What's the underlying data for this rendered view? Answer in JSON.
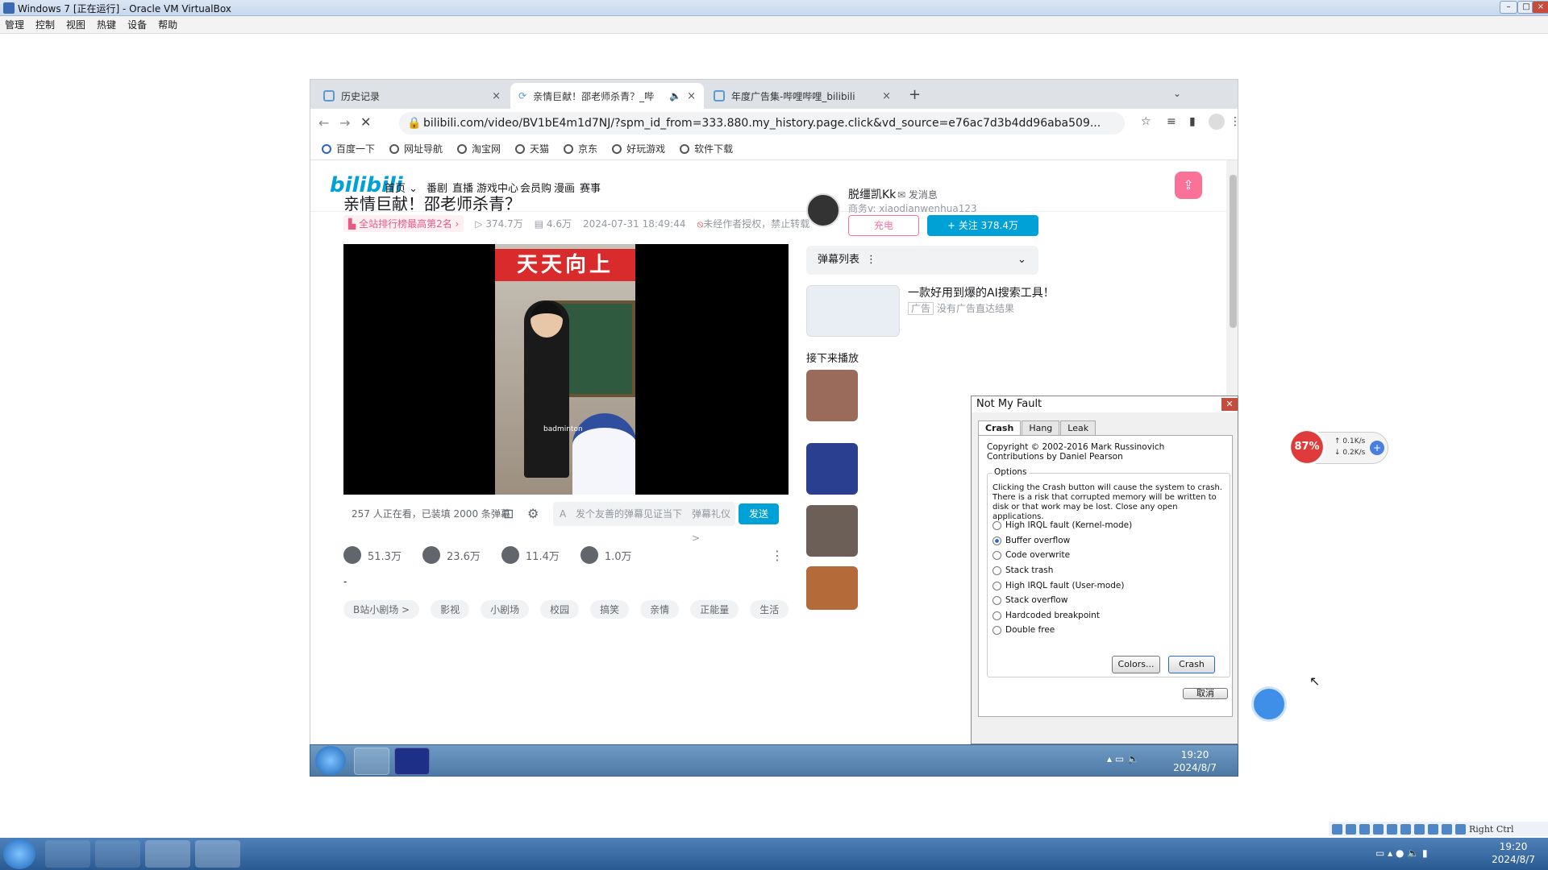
{
  "host": {
    "window_title": "Windows 7 [正在运行] - Oracle VM VirtualBox",
    "menu": [
      "管理",
      "控制",
      "视图",
      "热键",
      "设备",
      "帮助"
    ],
    "clock_time": "19:20",
    "clock_date": "2024/8/7",
    "tray_label": "Right Ctrl"
  },
  "browser": {
    "tabs": [
      {
        "label": "历史记录"
      },
      {
        "label": "亲情巨献！邵老师杀青？_哔"
      },
      {
        "label": "年度广告集-哔哩哔哩_bilibili"
      }
    ],
    "new_tab": "+",
    "url": "bilibili.com/video/BV1bE4m1d7NJ/?spm_id_from=333.880.my_history.page.click&vd_source=e76ac7d3b4dd96aba509...",
    "bookmarks": [
      "百度一下",
      "网址导航",
      "淘宝网",
      "天猫",
      "京东",
      "好玩游戏",
      "软件下载"
    ]
  },
  "bili": {
    "nav": {
      "home": "首页",
      "links": [
        "番剧",
        "直播",
        "游戏中心",
        "会员购",
        "漫画",
        "赛事"
      ]
    },
    "video": {
      "title": "亲情巨献！邵老师杀青？",
      "rank": "全站排行榜最高第2名",
      "views": "374.7万",
      "danmaku": "4.6万",
      "date": "2024-07-31 18:49:44",
      "copyright": "未经作者授权，禁止转载",
      "frame_banner": "天天向上",
      "frame_caption": "badminton"
    },
    "danmu_bar": {
      "viewers": "257 人正在看，已装填 2000 条弹幕",
      "placeholder": "发个友善的弹幕见证当下",
      "etiquette": "弹幕礼仪 >",
      "send": "发送"
    },
    "actions": {
      "like": "51.3万",
      "coin": "23.6万",
      "fav": "11.4万",
      "share": "1.0万"
    },
    "desc": "-",
    "tags": [
      "B站小剧场 >",
      "影视",
      "小剧场",
      "校园",
      "搞笑",
      "亲情",
      "正能量",
      "生活"
    ],
    "up": {
      "name": "脱缰凯Kk",
      "msg": "发消息",
      "desc": "商务v: xiaodianwenhua123",
      "charge": "充电",
      "follow": "+ 关注 378.4万"
    },
    "danmu_list": "弹幕列表",
    "ad": {
      "title": "一款好用到爆的AI搜索工具！",
      "badge": "广告",
      "sub": "没有广告直达结果"
    },
    "next_label": "接下来播放"
  },
  "nmf": {
    "title": "Not My Fault",
    "tabs": [
      "Crash",
      "Hang",
      "Leak"
    ],
    "copyright": "Copyright © 2002-2016 Mark Russinovich",
    "contrib": "Contributions by Daniel Pearson",
    "options_label": "Options",
    "warning": "Clicking the Crash button will cause the system to crash. There is a risk that corrupted memory will be written to disk or that work may be lost. Close any open applications.",
    "options": [
      "High IRQL fault (Kernel-mode)",
      "Buffer overflow",
      "Code overwrite",
      "Stack trash",
      "High IRQL fault (User-mode)",
      "Stack overflow",
      "Hardcoded breakpoint",
      "Double free"
    ],
    "selected": 1,
    "colors_btn": "Colors...",
    "crash_btn": "Crash",
    "cancel_btn": "取消"
  },
  "speed": {
    "percent": "87%",
    "up": "0.1K/s",
    "down": "0.2K/s"
  }
}
